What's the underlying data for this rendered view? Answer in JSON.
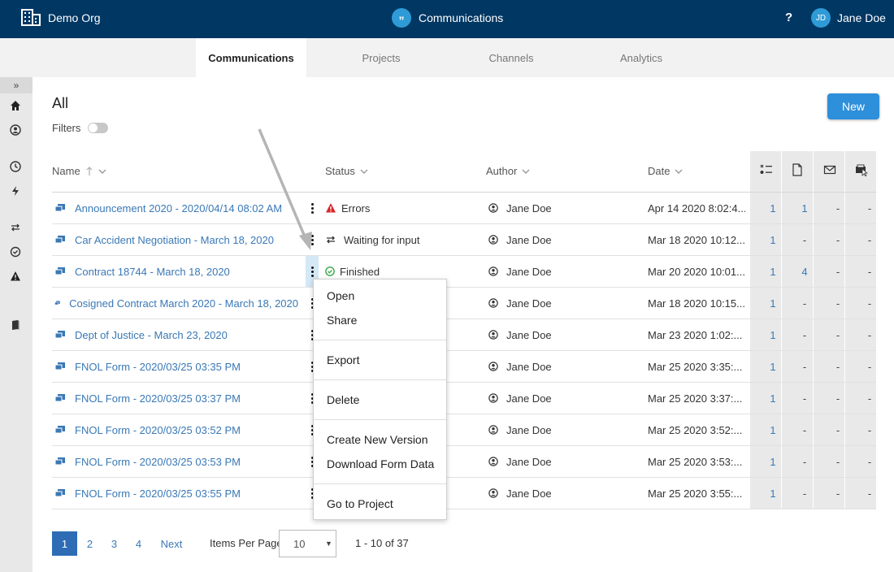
{
  "header": {
    "org_name": "Demo Org",
    "app_title": "Communications",
    "app_icon_glyph": "”",
    "help_label": "?",
    "user_initials": "JD",
    "user_name": "Jane Doe"
  },
  "tabs": [
    {
      "label": "Communications",
      "active": true
    },
    {
      "label": "Projects",
      "active": false
    },
    {
      "label": "Channels",
      "active": false
    },
    {
      "label": "Analytics",
      "active": false
    }
  ],
  "sidebar": {
    "expand_glyph": "»",
    "items": [
      "home-icon",
      "user-circle-icon",
      "clock-icon",
      "lightning-icon",
      "exchange-icon",
      "check-circle-icon",
      "warning-icon",
      "book-icon"
    ]
  },
  "page": {
    "title": "All",
    "filters_label": "Filters",
    "new_button": "New"
  },
  "table": {
    "headers": {
      "name": "Name",
      "status": "Status",
      "author": "Author",
      "date": "Date"
    },
    "rows": [
      {
        "name": "Announcement 2020 - 2020/04/14 08:02 AM",
        "status": "Errors",
        "status_icon": "error-icon",
        "author": "Jane Doe",
        "date": "Apr 14 2020 8:02:4...",
        "c1": "1",
        "c2": "1",
        "c3": "-",
        "c4": "-"
      },
      {
        "name": "Car Accident Negotiation - March 18, 2020",
        "status": "Waiting for input",
        "status_icon": "exchange-icon",
        "author": "Jane Doe",
        "date": "Mar 18 2020 10:12...",
        "c1": "1",
        "c2": "-",
        "c3": "-",
        "c4": "-"
      },
      {
        "name": "Contract 18744 - March 18, 2020",
        "status": "Finished",
        "status_icon": "check-circle-icon",
        "author": "Jane Doe",
        "date": "Mar 20 2020 10:01...",
        "c1": "1",
        "c2": "4",
        "c3": "-",
        "c4": "-"
      },
      {
        "name": "Cosigned Contract March 2020 - March 18, 2020",
        "status": "",
        "status_icon": "",
        "author": "Jane Doe",
        "date": "Mar 18 2020 10:15...",
        "c1": "1",
        "c2": "-",
        "c3": "-",
        "c4": "-"
      },
      {
        "name": "Dept of Justice - March 23, 2020",
        "status": "",
        "status_icon": "",
        "author": "Jane Doe",
        "date": "Mar 23 2020 1:02:...",
        "c1": "1",
        "c2": "-",
        "c3": "-",
        "c4": "-"
      },
      {
        "name": "FNOL Form - 2020/03/25 03:35 PM",
        "status": "",
        "status_icon": "",
        "author": "Jane Doe",
        "date": "Mar 25 2020 3:35:...",
        "c1": "1",
        "c2": "-",
        "c3": "-",
        "c4": "-"
      },
      {
        "name": "FNOL Form - 2020/03/25 03:37 PM",
        "status": "",
        "status_icon": "",
        "author": "Jane Doe",
        "date": "Mar 25 2020 3:37:...",
        "c1": "1",
        "c2": "-",
        "c3": "-",
        "c4": "-"
      },
      {
        "name": "FNOL Form - 2020/03/25 03:52 PM",
        "status": "",
        "status_icon": "",
        "author": "Jane Doe",
        "date": "Mar 25 2020 3:52:...",
        "c1": "1",
        "c2": "-",
        "c3": "-",
        "c4": "-"
      },
      {
        "name": "FNOL Form - 2020/03/25 03:53 PM",
        "status": "",
        "status_icon": "",
        "author": "Jane Doe",
        "date": "Mar 25 2020 3:53:...",
        "c1": "1",
        "c2": "-",
        "c3": "-",
        "c4": "-"
      },
      {
        "name": "FNOL Form - 2020/03/25 03:55 PM",
        "status": "",
        "status_icon": "",
        "author": "Jane Doe",
        "date": "Mar 25 2020 3:55:...",
        "c1": "1",
        "c2": "-",
        "c3": "-",
        "c4": "-"
      }
    ]
  },
  "context_menu": {
    "groups": [
      [
        "Open",
        "Share"
      ],
      [
        "Export"
      ],
      [
        "Delete"
      ],
      [
        "Create New Version",
        "Download Form Data"
      ],
      [
        "Go to Project"
      ]
    ]
  },
  "pagination": {
    "pages": [
      "1",
      "2",
      "3",
      "4"
    ],
    "current": "1",
    "next_label": "Next",
    "items_per_page_label": "Items Per Page",
    "items_per_page_value": "10",
    "range_text": "1 - 10 of 37"
  },
  "colors": {
    "topbar": "#003763",
    "accent": "#2e8fdb",
    "link": "#3a78b5",
    "error": "#d9242a",
    "success": "#3aa64a"
  }
}
